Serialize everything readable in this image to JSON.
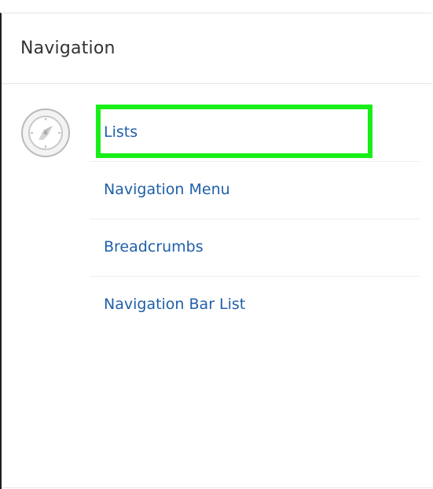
{
  "panel": {
    "title": "Navigation",
    "icon": "compass-icon",
    "items": [
      {
        "label": "Lists",
        "highlighted": true
      },
      {
        "label": "Navigation Menu"
      },
      {
        "label": "Breadcrumbs"
      },
      {
        "label": "Navigation Bar List"
      }
    ]
  },
  "colors": {
    "link": "#1f5fa8",
    "highlight": "#18ee18",
    "title": "#333333"
  }
}
